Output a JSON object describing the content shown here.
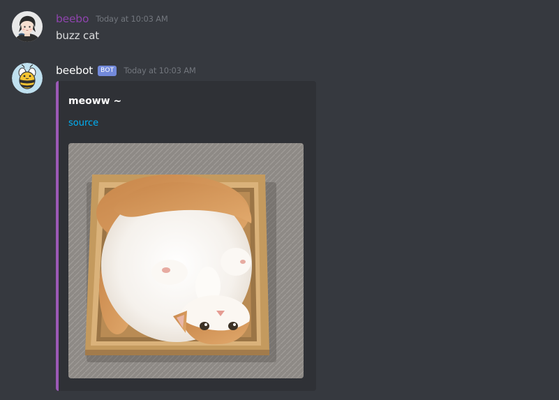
{
  "messages": [
    {
      "username": "beebo",
      "username_color": "#8e44ad",
      "timestamp": "Today at 10:03 AM",
      "content": "buzz cat",
      "avatar": "user-avatar"
    },
    {
      "username": "beebot",
      "username_color": "#ffffff",
      "bot_tag": "BOT",
      "timestamp": "Today at 10:03 AM",
      "avatar": "bee-icon",
      "embed": {
        "title": "meoww ~",
        "link": "source",
        "accent_color": "#9b59b6",
        "link_color": "#00b0f4",
        "image": "cat-in-box-photo"
      }
    }
  ],
  "colors": {
    "background": "#36393f",
    "embed_background": "#2f3136",
    "bot_tag": "#7289da",
    "timestamp": "#72767d"
  }
}
